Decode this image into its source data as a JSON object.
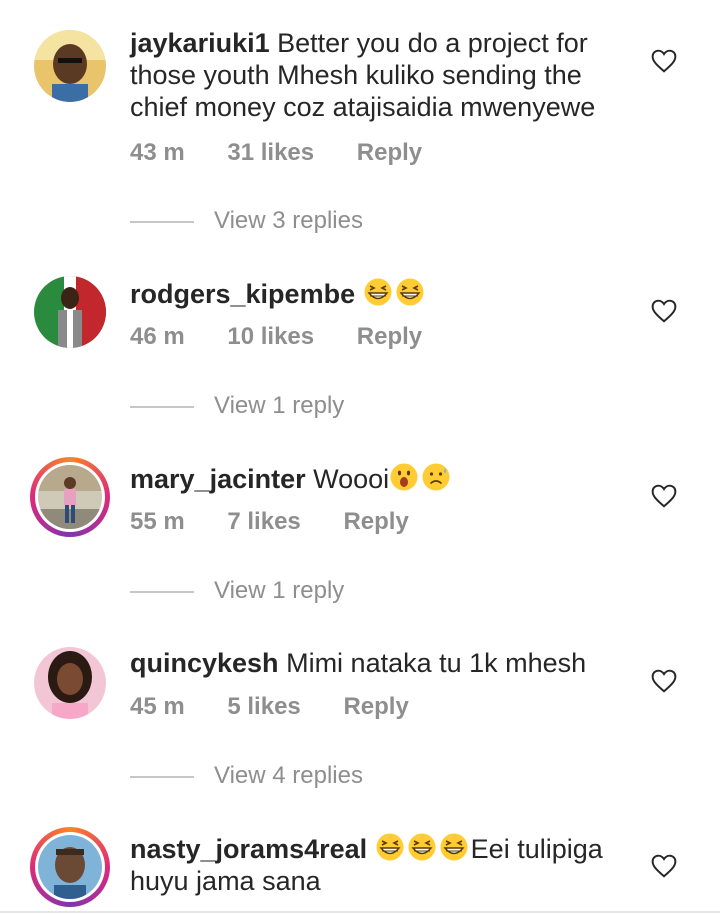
{
  "comments": [
    {
      "username": "jaykariuki1",
      "text": "Better you do a project for those youth Mhesh kuliko sending the chief money coz atajisaidia mwenyewe",
      "time": "43 m",
      "likes": "31 likes",
      "reply_label": "Reply",
      "view_replies": "View 3 replies",
      "avatar_ring": false,
      "emojis": []
    },
    {
      "username": "rodgers_kipembe",
      "text": "",
      "time": "46 m",
      "likes": "10 likes",
      "reply_label": "Reply",
      "view_replies": "View 1 reply",
      "avatar_ring": false,
      "emojis": [
        "grinning-squint-emoji",
        "grinning-squint-emoji"
      ]
    },
    {
      "username": "mary_jacinter",
      "text": "Woooi",
      "time": "55 m",
      "likes": "7 likes",
      "reply_label": "Reply",
      "view_replies": "View 1 reply",
      "avatar_ring": true,
      "emojis": [
        "astonished-emoji",
        "frowning-sweat-emoji"
      ]
    },
    {
      "username": "quincykesh",
      "text": "Mimi nataka tu 1k mhesh",
      "time": "45 m",
      "likes": "5 likes",
      "reply_label": "Reply",
      "view_replies": "View 4 replies",
      "avatar_ring": false,
      "emojis": []
    },
    {
      "username": "nasty_jorams4real",
      "text_after_emojis": "Eei tulipiga huyu jama sana",
      "avatar_ring": true,
      "emojis": [
        "grinning-squint-emoji",
        "grinning-squint-emoji",
        "grinning-squint-emoji"
      ]
    }
  ],
  "colors": {
    "text": "#262626",
    "secondary": "#8e8e8e",
    "divider": "#c7c7c7",
    "story_ring_start": "#f58529",
    "story_ring_end": "#dd2a7b"
  }
}
